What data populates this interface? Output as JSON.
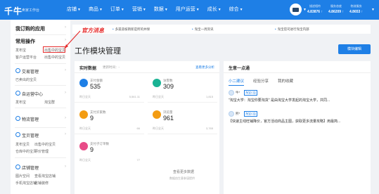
{
  "header": {
    "logo": "千牛",
    "logo_sub": "卖家工作台",
    "nav": [
      {
        "label": "店铺"
      },
      {
        "label": "商品"
      },
      {
        "label": "订单"
      },
      {
        "label": "营销"
      },
      {
        "label": "数据"
      },
      {
        "label": "用户运营"
      },
      {
        "label": "成长"
      },
      {
        "label": "综合"
      }
    ],
    "metrics": [
      {
        "label": "描述相符",
        "value": "4.83876 ↑"
      },
      {
        "label": "服务态度",
        "value": "4.86209 ↑"
      },
      {
        "label": "物流服务",
        "value": "4.8653 ↑"
      }
    ]
  },
  "sidebar": {
    "favorites_title": "我订购的应用",
    "common_title": "常用操作",
    "common_links": [
      "发布宝",
      "出售中的宝贝",
      "客户运营平台",
      "出售中的宝贝"
    ],
    "sections": [
      {
        "title": "交易管理",
        "links": [
          "已卖出的宝贝"
        ]
      },
      {
        "title": "自运营中心",
        "links": [
          "发布宝",
          "淘宝群"
        ]
      },
      {
        "title": "物流管理",
        "links": []
      },
      {
        "title": "宝贝管理",
        "links": [
          "发布宝贝",
          "出售中的宝贝",
          "仓库中的宝贝",
          "评价管理"
        ]
      },
      {
        "title": "店铺管理",
        "links": [
          "图片空间",
          "查看淘宝店铺",
          "手机淘宝店铺",
          "店铺装修"
        ]
      }
    ]
  },
  "annotation": {
    "text": "官方消息"
  },
  "notices": [
    "多渠道核销新是所的并保",
    "淘宝一周资讯",
    "淘宝官司进行淘宝内部"
  ],
  "main": {
    "title": "工作模块管理",
    "edit_button": "模块编辑"
  },
  "realtime": {
    "title": "实时数据",
    "time": "更新时间：-",
    "more": "查看更多分析",
    "tiles": [
      {
        "label": "支付金额",
        "value": "535",
        "foot": "昨日全天",
        "foot_value": "5,561.11",
        "color": "#1e7fe6"
      },
      {
        "label": "访客数",
        "value": "309",
        "foot": "昨日全天",
        "foot_value": "1,815",
        "color": "#1ab394"
      },
      {
        "label": "支付买家数",
        "value": "9",
        "foot": "昨日全天",
        "foot_value": "66",
        "color": "#f39c12"
      },
      {
        "label": "浏览量",
        "value": "961",
        "foot": "昨日全天",
        "foot_value": "3,765",
        "color": "#f39c12"
      },
      {
        "label": "支付子订单数",
        "value": "9",
        "foot": "昨日全天",
        "foot_value": "77",
        "color": "#e84c88"
      }
    ],
    "empty_text": "查看更多数据",
    "empty_sub": "数据由生意参谋提供"
  },
  "growth": {
    "title": "生意一点通",
    "tabs": [
      "小二建议",
      "经验分享",
      "我的收藏"
    ],
    "active_tab": 0,
    "posts": [
      {
        "author": "牛*",
        "tag": "淘宝C店",
        "text": "\"淘宝大学：淘宝你要淘货\" 是由淘宝大学发起的淘宝大学，共同..."
      },
      {
        "author": "熙*",
        "tag": "淘宝C店",
        "text": "【快速主线旺铺降价，官方活动商品主图，获取更多流量攻略】用最简..."
      }
    ]
  }
}
